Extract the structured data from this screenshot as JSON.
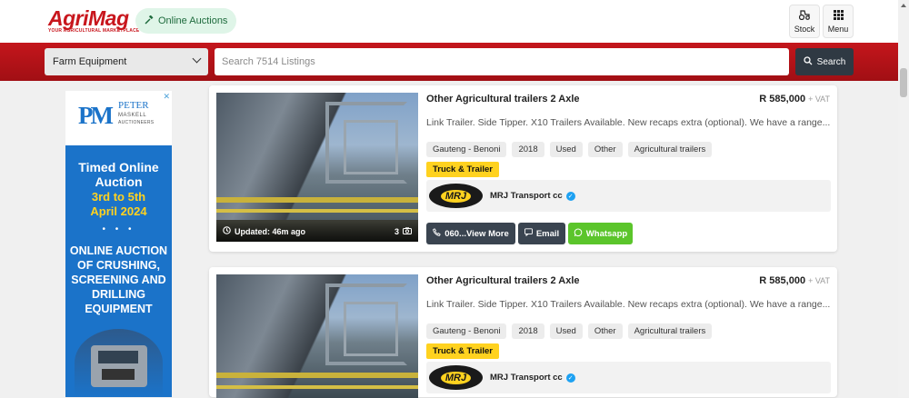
{
  "header": {
    "logo": "AgriMag",
    "tagline": "YOUR AGRICULTURAL MARKETPLACE",
    "auctions_label": "Online Auctions",
    "stock_label": "Stock",
    "menu_label": "Menu"
  },
  "search": {
    "category": "Farm Equipment",
    "placeholder": "Search 7514 Listings",
    "button_label": "Search"
  },
  "ad": {
    "peter": "PETER",
    "maskell": "MASKELL",
    "auctioneers": "AUCTIONEERS",
    "title_line1": "Timed Online",
    "title_line2": "Auction",
    "date_line1": "3rd to 5th",
    "date_line2": "April 2024",
    "dots": "• • •",
    "body_line1": "ONLINE AUCTION",
    "body_line2": "OF CRUSHING,",
    "body_line3": "SCREENING AND",
    "body_line4": "DRILLING",
    "body_line5": "EQUIPMENT"
  },
  "listings": [
    {
      "title": "Other Agricultural trailers 2 Axle",
      "price": "R 585,000",
      "vat": "+ VAT",
      "description": "Link Trailer. Side Tipper. X10 Trailers Available. New recaps extra (optional). We have a range...",
      "tags": [
        "Gauteng - Benoni",
        "2018",
        "Used",
        "Other",
        "Agricultural trailers"
      ],
      "badge": "Truck & Trailer",
      "seller": "MRJ Transport cc",
      "seller_logo_text": "MRJ",
      "updated": "Updated: 46m ago",
      "photo_count": "3",
      "phone_label": "060...View More",
      "email_label": "Email",
      "whatsapp_label": "Whatsapp"
    },
    {
      "title": "Other Agricultural trailers 2 Axle",
      "price": "R 585,000",
      "vat": "+ VAT",
      "description": "Link Trailer. Side Tipper. X10 Trailers Available. New recaps extra (optional). We have a range...",
      "tags": [
        "Gauteng - Benoni",
        "2018",
        "Used",
        "Other",
        "Agricultural trailers"
      ],
      "badge": "Truck & Trailer",
      "seller": "MRJ Transport cc",
      "seller_logo_text": "MRJ"
    }
  ],
  "colors": {
    "brand_red": "#c8161d",
    "badge_yellow": "#ffd21f",
    "whatsapp_green": "#5bc52b",
    "dark_button": "#3a4450"
  }
}
